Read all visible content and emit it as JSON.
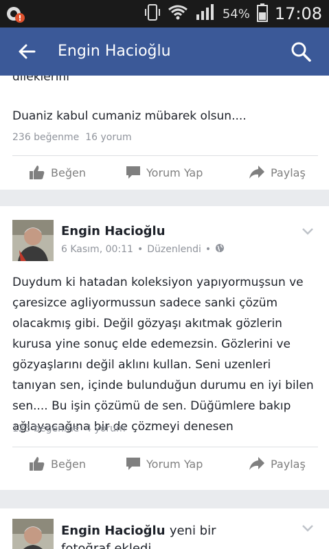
{
  "status_bar": {
    "battery_percent": "54%",
    "time": "17:08"
  },
  "app_bar": {
    "title": "Engin Hacioğlu"
  },
  "post1": {
    "clipped_text": "dileklerini",
    "text": "Duaniz kabul cumaniz mübarek olsun....",
    "likes": "236 beğenme",
    "comments": "16 yorum"
  },
  "actions": {
    "like": "Beğen",
    "comment": "Yorum Yap",
    "share": "Paylaş"
  },
  "post2": {
    "author": "Engin Hacioğlu",
    "date": "6 Kasım, 00:11",
    "edited": "Düzenlendi",
    "text": "Duydum ki hatadan koleksiyon yapıyormuşsun ve çaresizce agliyormussun sadece sanki çözüm olacakmış gibi. Değil gözyaşı akıtmak gözlerin kurusa yine sonuç elde edemezsin. Gözlerini ve gözyaşlarını değil aklını kullan. Seni uzenleri tanıyan sen, içinde bulunduğun durumu en iyi bilen sen.... Bu işin çözümü de sen. Düğümlere bakıp ağlayacağına bir de çözmeyi denesen",
    "likes": "125 beğenme",
    "comments": "4 yorum"
  },
  "post3": {
    "author": "Engin Hacioğlu",
    "action_text": "yeni bir fotoğraf ekledi."
  }
}
